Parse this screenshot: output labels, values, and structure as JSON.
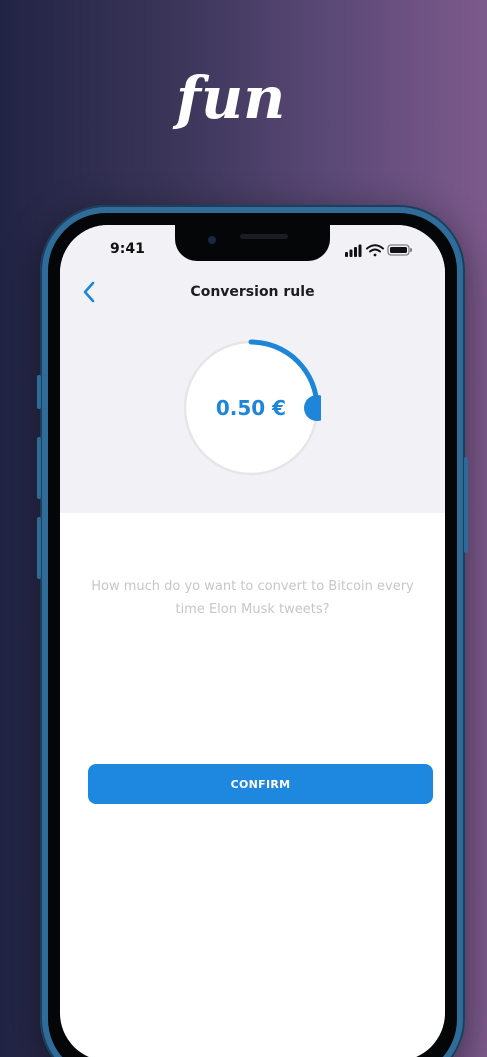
{
  "brand": {
    "logo_text": "fun",
    "logo_color": "#ffffff"
  },
  "status_bar": {
    "time": "9:41",
    "icons": [
      "cellular-signal-icon",
      "wifi-icon",
      "battery-icon"
    ]
  },
  "nav": {
    "back_icon": "chevron-left-icon",
    "title": "Conversion rule"
  },
  "dial": {
    "value_text": "0.50 €",
    "progress_fraction": 0.25,
    "accent_color": "#1e86d9",
    "track_color": "#e6e6ea"
  },
  "prompt": {
    "text": "How much do yo want to convert to Bitcoin every time Elon Musk tweets?"
  },
  "actions": {
    "confirm_label": "CONFIRM",
    "confirm_color": "#1e88e0"
  }
}
